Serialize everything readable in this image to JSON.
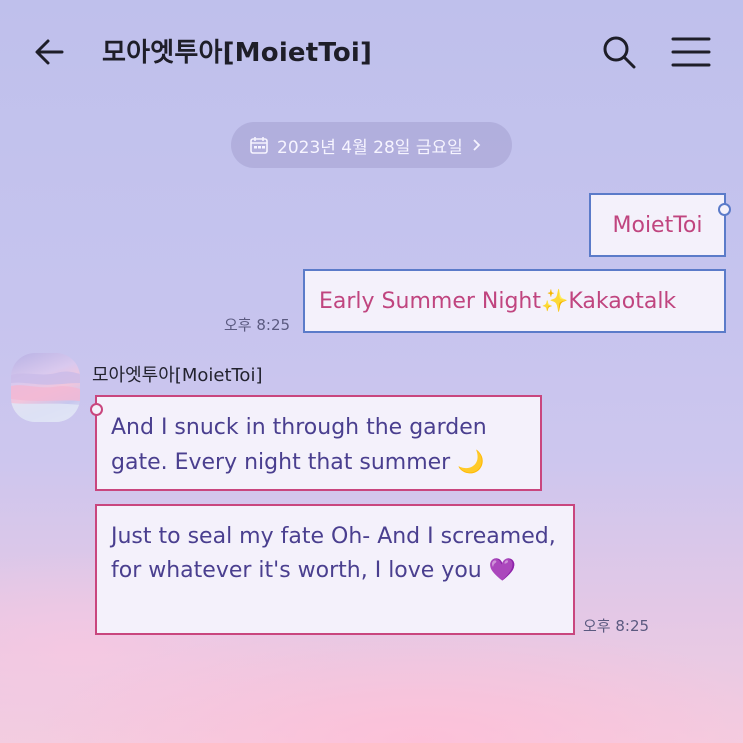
{
  "header": {
    "title": "모아엣투아[MoietToi]",
    "back_icon": "back-arrow-icon",
    "search_icon": "search-icon",
    "menu_icon": "hamburger-menu-icon"
  },
  "date_divider": {
    "text": "2023년 4월 28일 금요일",
    "icon": "calendar-icon",
    "chevron_icon": "chevron-right-icon"
  },
  "messages": [
    {
      "direction": "out",
      "text": "MoietToi"
    },
    {
      "direction": "out",
      "text": "Early Summer Night✨Kakaotalk",
      "time": "오후 8:25"
    },
    {
      "direction": "in",
      "sender": "모아엣투아[MoietToi]",
      "text": "And I snuck in through the garden gate. Every night that summer 🌙"
    },
    {
      "direction": "in",
      "text": "Just to seal my fate Oh- And I screamed, for whatever it's worth, I love you 💜",
      "time": "오후 8:25"
    }
  ],
  "colors": {
    "outgoing_border": "#5b7bc9",
    "incoming_border": "#c9467e",
    "outgoing_text": "#c0457f",
    "incoming_text": "#4a3f8f"
  }
}
